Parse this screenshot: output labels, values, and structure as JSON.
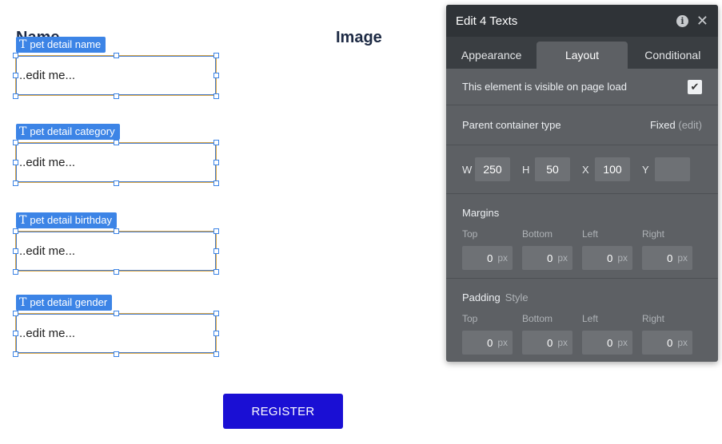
{
  "canvas": {
    "headings": {
      "name": "Name",
      "image": "Image"
    },
    "fields": [
      {
        "tag": "pet detail name",
        "placeholder": "..edit me..."
      },
      {
        "tag": "pet detail category",
        "placeholder": "..edit me..."
      },
      {
        "tag": "pet detail birthday",
        "placeholder": "..edit me..."
      },
      {
        "tag": "pet detail gender",
        "placeholder": "..edit me..."
      }
    ],
    "register_label": "REGISTER"
  },
  "panel": {
    "title": "Edit 4 Texts",
    "tabs": [
      "Appearance",
      "Layout",
      "Conditional"
    ],
    "active_tab": "Layout",
    "visible_label": "This element is visible on page load",
    "visible_checked": true,
    "container_label": "Parent container type",
    "container_value": "Fixed",
    "container_edit": "(edit)",
    "dims": {
      "w_label": "W",
      "w": "250",
      "h_label": "H",
      "h": "50",
      "x_label": "X",
      "x": "100",
      "y_label": "Y",
      "y": ""
    },
    "margins": {
      "title": "Margins",
      "labels": [
        "Top",
        "Bottom",
        "Left",
        "Right"
      ],
      "values": [
        "0",
        "0",
        "0",
        "0"
      ],
      "unit": "px"
    },
    "padding": {
      "title": "Padding",
      "style_label": "Style",
      "labels": [
        "Top",
        "Bottom",
        "Left",
        "Right"
      ],
      "values": [
        "0",
        "0",
        "0",
        "0"
      ],
      "unit": "px"
    }
  },
  "colors": {
    "accent": "#3c84e6",
    "register_button": "#1a0fd4",
    "panel_bg": "#5d6064"
  }
}
